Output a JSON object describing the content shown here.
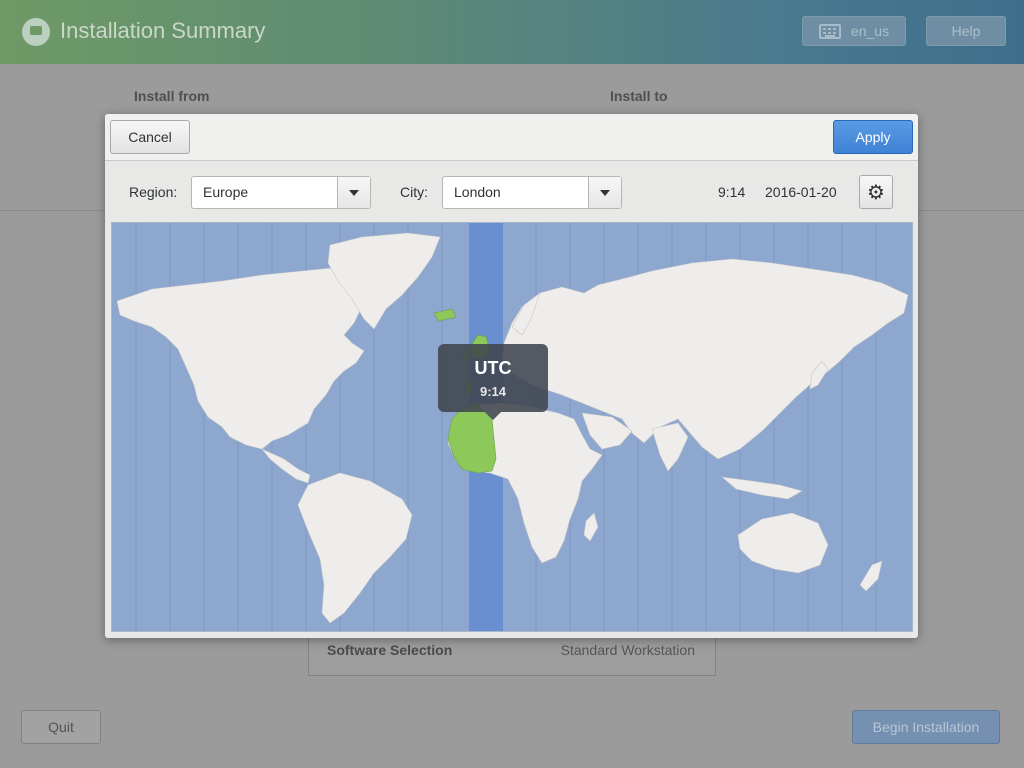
{
  "window": {
    "title": "Installation Summary",
    "keyboard_label": "en_us",
    "help_label": "Help"
  },
  "background": {
    "install_from": "Install from",
    "install_to": "Install to",
    "software_selection": {
      "name": "Software Selection",
      "value": "Standard Workstation"
    },
    "quit_label": "Quit",
    "begin_label": "Begin Installation"
  },
  "dialog": {
    "cancel_label": "Cancel",
    "apply_label": "Apply",
    "region_label": "Region:",
    "region_value": "Europe",
    "city_label": "City:",
    "city_value": "London",
    "time": "9:14",
    "date": "2016-01-20"
  },
  "map": {
    "tooltip_zone": "UTC",
    "tooltip_time": "9:14",
    "ocean_color": "#8ea7cf",
    "land_color": "#efedeb",
    "selected_zone_color": "#6a8fd0",
    "highlight_land_color": "#8cc85a"
  },
  "icons": {
    "logo": "installer-logo-icon",
    "keyboard": "keyboard-icon",
    "dropdown": "chevron-down-icon",
    "settings": "gear-icon"
  }
}
